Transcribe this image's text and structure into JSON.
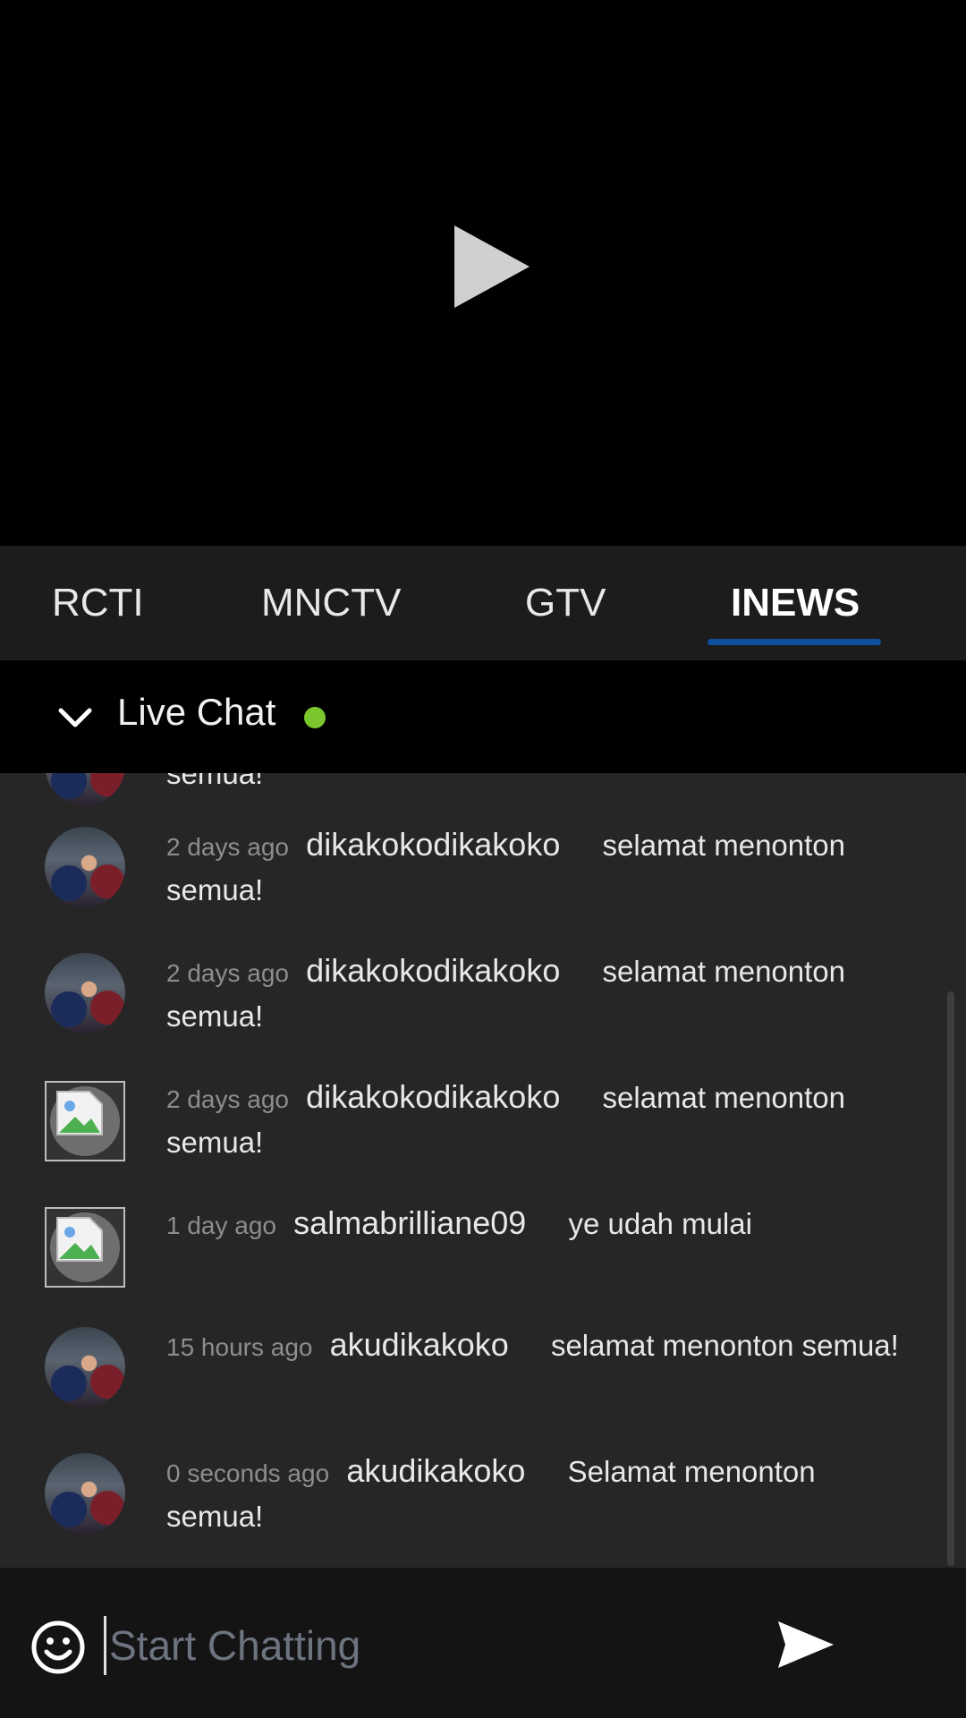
{
  "tabs": [
    {
      "label": "RCTI"
    },
    {
      "label": "MNCTV"
    },
    {
      "label": "GTV"
    },
    {
      "label": "INEWS",
      "active": true
    }
  ],
  "chat": {
    "title": "Live Chat",
    "live_color": "#7bc62d",
    "partial_text": "semua!",
    "messages": [
      {
        "time": "2 days ago",
        "user": "dikakokodikakoko",
        "text": "selamat menonton semua!",
        "avatar": "photo"
      },
      {
        "time": "2 days ago",
        "user": "dikakokodikakoko",
        "text": "selamat menonton semua!",
        "avatar": "photo"
      },
      {
        "time": "2 days ago",
        "user": "dikakokodikakoko",
        "text": "selamat menonton semua!",
        "avatar": "broken-image"
      },
      {
        "time": "1 day ago",
        "user": "salmabrilliane09",
        "text": "ye udah mulai",
        "avatar": "broken-image"
      },
      {
        "time": "15 hours ago",
        "user": "akudikakoko",
        "text": "selamat menonton semua!",
        "avatar": "photo"
      },
      {
        "time": "0 seconds ago",
        "user": "akudikakoko",
        "text": "Selamat menonton semua!",
        "avatar": "photo"
      }
    ]
  },
  "composer": {
    "placeholder": "Start Chatting",
    "value": ""
  },
  "colors": {
    "accent": "#0e4fa0",
    "chat_bg": "#262626",
    "tab_bg": "#1c1c1c"
  }
}
